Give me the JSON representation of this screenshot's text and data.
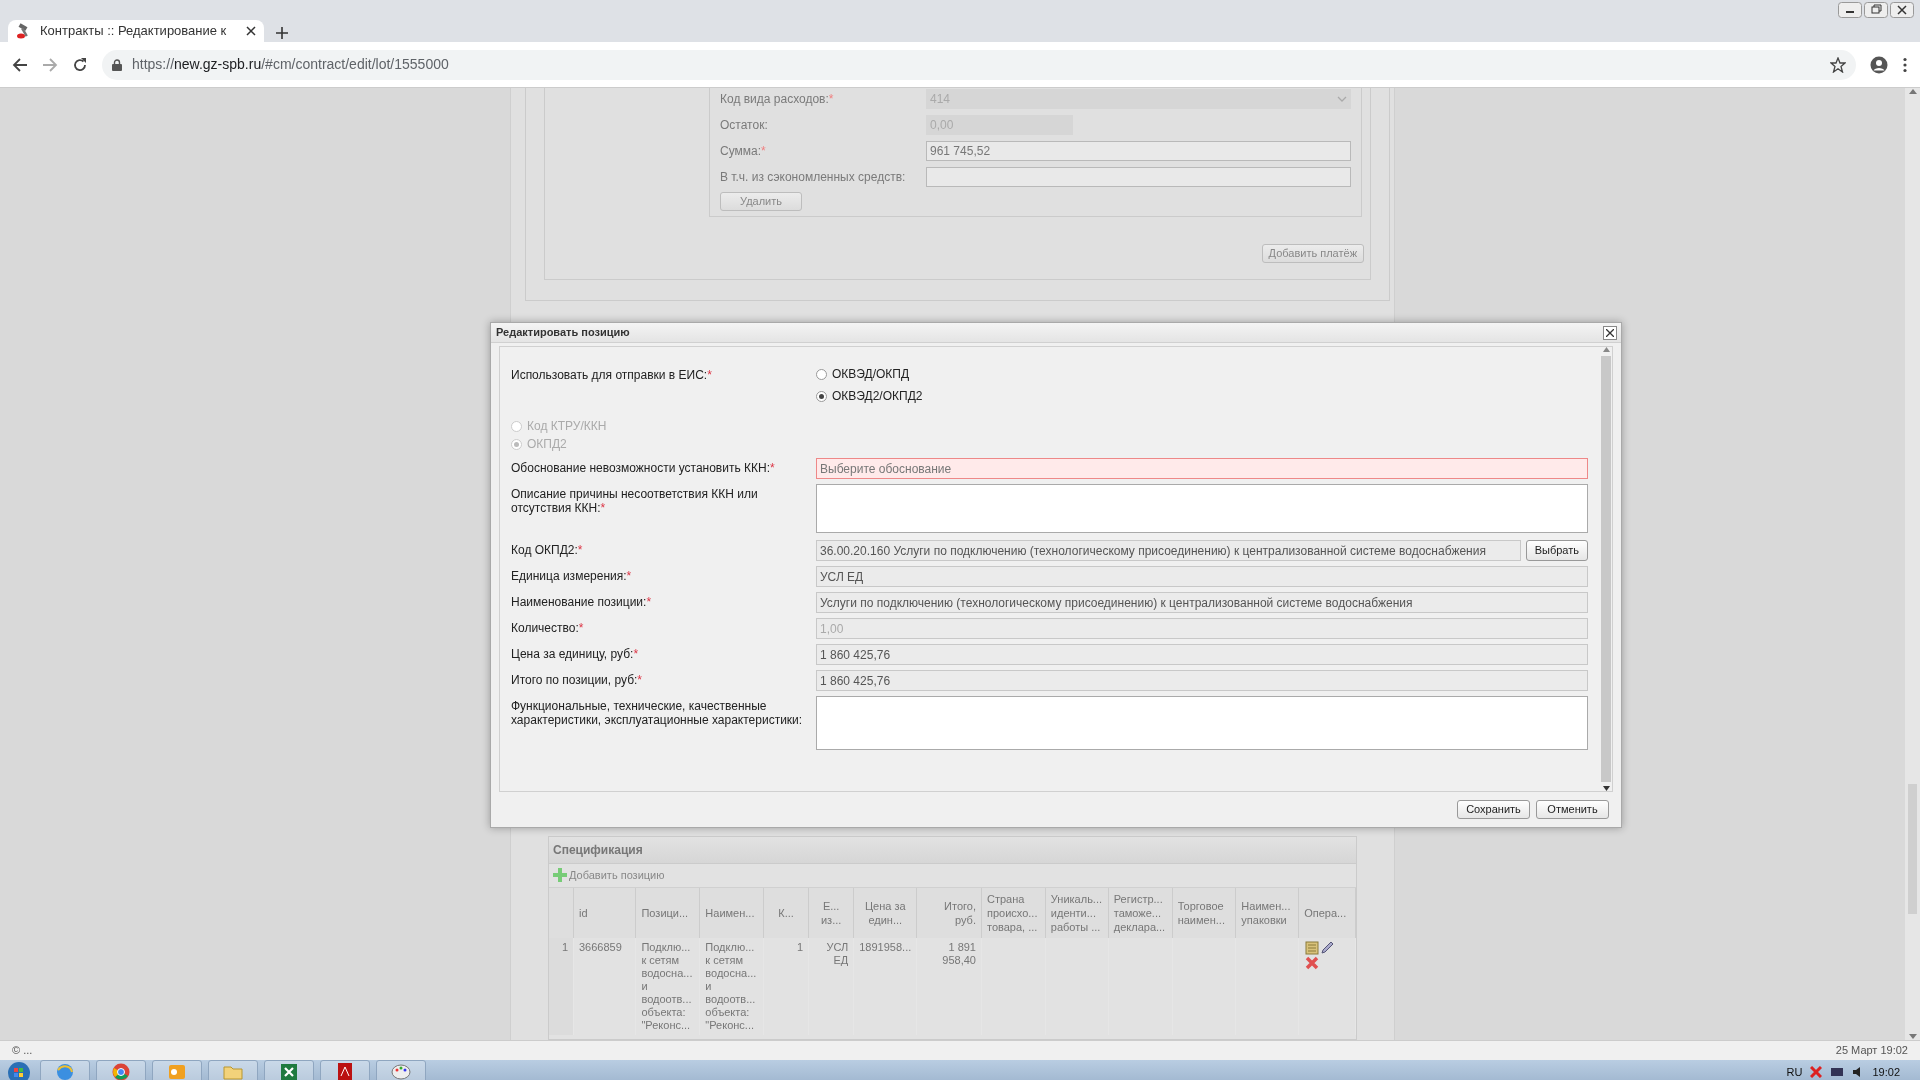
{
  "browser": {
    "tab_title": "Контракты :: Редактирование к",
    "url_scheme": "https://",
    "url_host": "new.gz-spb.ru",
    "url_path": "/#cm/contract/edit/lot/1555000"
  },
  "background_form": {
    "fields": [
      {
        "label": "Код вида расходов:",
        "mark": "*",
        "kind": "select",
        "value": "414",
        "disabled": true
      },
      {
        "label": "Остаток:",
        "kind": "short_input",
        "value": "0,00",
        "disabled": true
      },
      {
        "label": "Сумма:",
        "mark": "*",
        "kind": "input",
        "value": "961 745,52",
        "disabled": false
      },
      {
        "label": "В т.ч. из сэкономленных средств:",
        "kind": "input",
        "disabled": false
      }
    ],
    "delete_button": "Удалить",
    "add_payment_button": "Добавить платёж"
  },
  "specification": {
    "title": "Спецификация",
    "add_button": "Добавить позицию",
    "columns": [
      "",
      "id",
      "Позици...",
      "Наимен...",
      "К...",
      "Е...\nиз...",
      "Цена за\nедин...",
      "Итого,\nруб.",
      "Страна\nпроисхо...\nтовара, ...",
      "Уникаль...\nиденти...\nработы ...",
      "Регистр...\nтаможе...\nдеклара...",
      "Торговое\nнаимен...",
      "Наимен...\nупаковки",
      "Опера..."
    ],
    "rows": [
      {
        "cells": [
          "1",
          "3666859",
          "Подклю...\nк сетям\nводосна...\nи\nводоотв...\nобъекта:\n\"Реконс...",
          "Подклю...\nк сетям\nводосна...\nи\nводоотв...\nобъекта:\n\"Реконс...",
          "1",
          "УСЛ\nЕД",
          "1891958...",
          "1 891\n958,40",
          "",
          "",
          "",
          "",
          "",
          ""
        ]
      }
    ]
  },
  "modal": {
    "title": "Редактировать позицию",
    "send_to_eis": {
      "label": "Использовать для отправки в ЕИС:",
      "mark": "*",
      "options": [
        {
          "label": "ОКВЭД/ОКПД",
          "selected": false
        },
        {
          "label": "ОКВЭД2/ОКПД2",
          "selected": true
        }
      ]
    },
    "classifier": {
      "disabled": true,
      "options": [
        {
          "label": "Код КТРУ/ККН",
          "selected": false
        },
        {
          "label": "ОКПД2",
          "selected": true
        }
      ]
    },
    "fields": [
      {
        "label": "Обоснование невозможности установить ККН:",
        "mark": "*",
        "kind": "select",
        "placeholder": "Выберите обоснование",
        "disabled": false,
        "invalid": true
      },
      {
        "label": "Описание причины несоответствия ККН или отсутствия ККН:",
        "mark": "*",
        "kind": "textarea",
        "disabled": false,
        "invalid": false
      },
      {
        "label": "Код ОКПД2:",
        "mark": "*",
        "kind": "picker",
        "value": "36.00.20.160 Услуги по подключению (технологическому присоединению) к централизованной системе водоснабжения",
        "button": "Выбрать",
        "disabled": false,
        "invalid": false
      },
      {
        "label": "Единица измерения:",
        "mark": "*",
        "kind": "input",
        "value": "УСЛ ЕД",
        "disabled": false,
        "invalid": false
      },
      {
        "label": "Наименование позиции:",
        "mark": "*",
        "kind": "input",
        "value": "Услуги по подключению (технологическому присоединению) к централизованной системе водоснабжения",
        "disabled": false,
        "invalid": false
      },
      {
        "label": "Количество:",
        "mark": "*",
        "kind": "input",
        "value": "1,00",
        "disabled": true,
        "invalid": false
      },
      {
        "label": "Цена за единицу, руб:",
        "mark": "*",
        "kind": "input",
        "value": "1 860 425,76",
        "disabled": false,
        "invalid": false
      },
      {
        "label": "Итого по позиции, руб:",
        "mark": "*",
        "kind": "input",
        "value": "1 860 425,76",
        "disabled": false,
        "invalid": false
      },
      {
        "label": "Функциональные, технические, качественные характеристики, эксплуатационные характеристики:",
        "kind": "textarea",
        "disabled": false,
        "invalid": false
      }
    ],
    "buttons": [
      "Сохранить",
      "Отменить"
    ]
  },
  "status_bar": {
    "left": "© ...",
    "right": "25 Март 19:02"
  },
  "taskbar": {
    "language": "RU",
    "clock": "19:02"
  }
}
